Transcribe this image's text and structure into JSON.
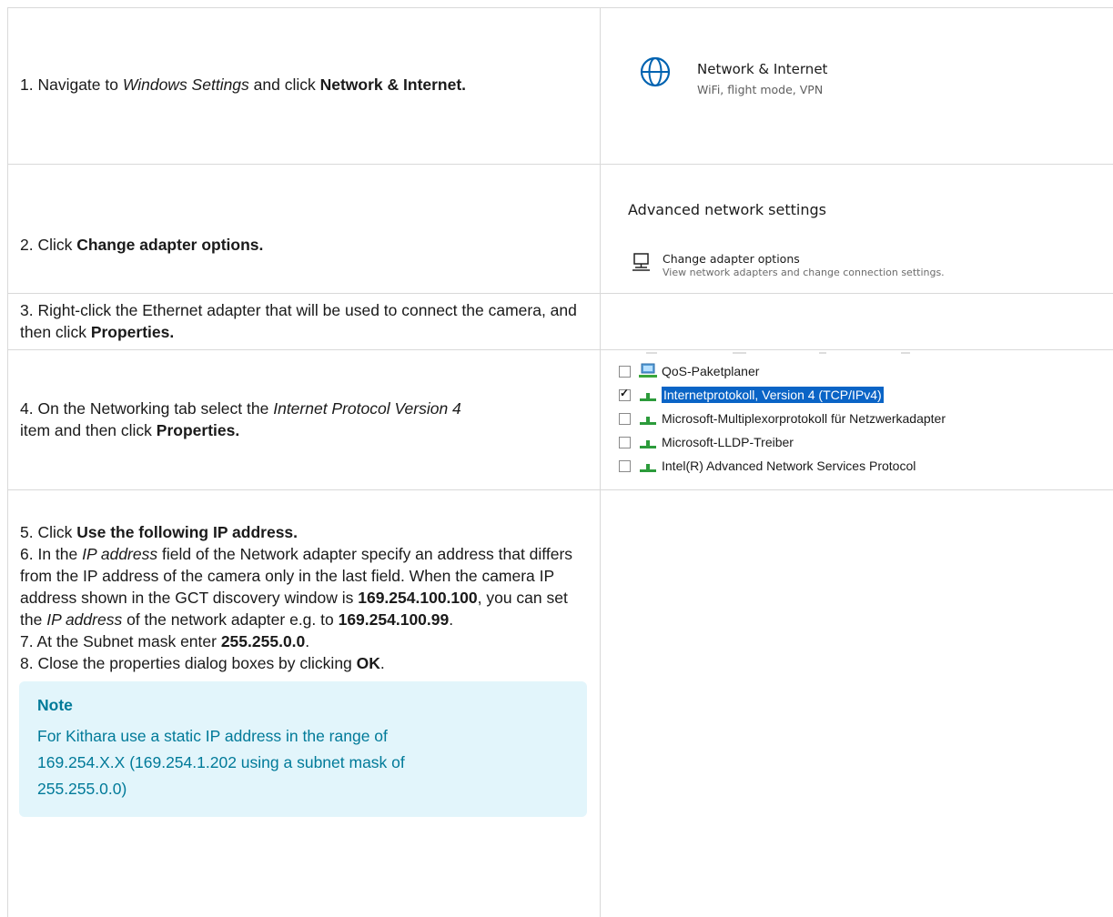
{
  "steps": {
    "s1": {
      "pre": "1. Navigate to ",
      "em": "Windows Settings",
      "mid": " and click ",
      "bold": "Network & Internet."
    },
    "s2": {
      "pre": "2. Click ",
      "bold": "Change adapter options."
    },
    "s3": {
      "pre": "3. Right-click the Ethernet adapter that will be used to connect the camera, and then click ",
      "bold": "Properties."
    },
    "s4": {
      "pre": "4. On the Networking tab select the ",
      "em": "Internet Protocol Version 4",
      "mid": " item and then click ",
      "bold": "Properties."
    },
    "s5": {
      "pre": "5. Click ",
      "bold": "Use the following IP address."
    },
    "s6": {
      "a": "6. In the ",
      "em1": "IP address",
      "b": " field of the Network adapter specify an address that differs from the IP address of the camera only in the last field. When the camera IP address shown in the GCT discovery window is ",
      "ip1": "169.254.100.100",
      "c": ", you can set the ",
      "em2": "IP address",
      "d": " of the network adapter e.g. to ",
      "ip2": "169.254.100.99",
      "e": "."
    },
    "s7": {
      "pre": "7. At the Subnet mask enter ",
      "bold": "255.255.0.0",
      "post": "."
    },
    "s8": {
      "pre": "8. Close the properties dialog boxes by clicking ",
      "bold": "OK",
      "post": "."
    }
  },
  "note": {
    "title": "Note",
    "body": "For Kithara use a static IP address in the range of 169.254.X.X (169.254.1.202 using a subnet mask of 255.255.0.0)"
  },
  "settings_tile": {
    "title": "Network & Internet",
    "subtitle": "WiFi, flight mode, VPN",
    "icon": "globe-icon"
  },
  "advanced": {
    "heading": "Advanced network settings",
    "item_title": "Change adapter options",
    "item_subtitle": "View network adapters and change connection settings.",
    "icon": "network-adapter-icon"
  },
  "protocols": [
    {
      "label": "QoS-Paketplaner",
      "checked": false,
      "selected": false,
      "icon": "qos-icon"
    },
    {
      "label": "Internetprotokoll, Version 4 (TCP/IPv4)",
      "checked": true,
      "selected": true,
      "icon": "protocol-icon"
    },
    {
      "label": "Microsoft-Multiplexorprotokoll für Netzwerkadapter",
      "checked": false,
      "selected": false,
      "icon": "protocol-icon"
    },
    {
      "label": "Microsoft-LLDP-Treiber",
      "checked": false,
      "selected": false,
      "icon": "protocol-icon"
    },
    {
      "label": "Intel(R) Advanced Network Services Protocol",
      "checked": false,
      "selected": false,
      "icon": "protocol-icon"
    }
  ]
}
